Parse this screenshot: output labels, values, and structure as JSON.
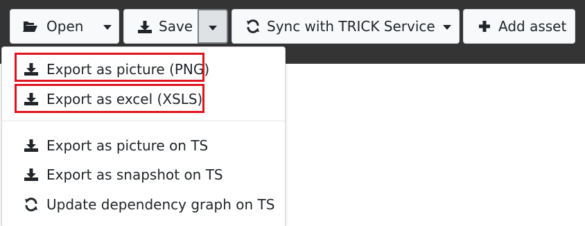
{
  "toolbar": {
    "open": {
      "label": "Open",
      "icon": "folder-open-icon"
    },
    "save": {
      "label": "Save",
      "icon": "download-icon"
    },
    "sync": {
      "label": "Sync with TRICK Service",
      "icon": "sync-icon"
    },
    "add_asset": {
      "label": "Add asset",
      "icon": "plus-icon"
    }
  },
  "save_menu": {
    "items": [
      {
        "label": "Export as picture (PNG)",
        "icon": "download-icon",
        "highlighted": true
      },
      {
        "label": "Export as excel (XSLS)",
        "icon": "download-icon",
        "highlighted": true
      },
      {
        "label": "Export as picture on TS",
        "icon": "download-icon"
      },
      {
        "label": "Export as snapshot on TS",
        "icon": "download-icon"
      },
      {
        "label": "Update dependency graph on TS",
        "icon": "sync-icon"
      }
    ]
  },
  "colors": {
    "toolbar_bg": "#343434",
    "button_bg": "#f8f9fa",
    "highlight": "#e0121d"
  }
}
